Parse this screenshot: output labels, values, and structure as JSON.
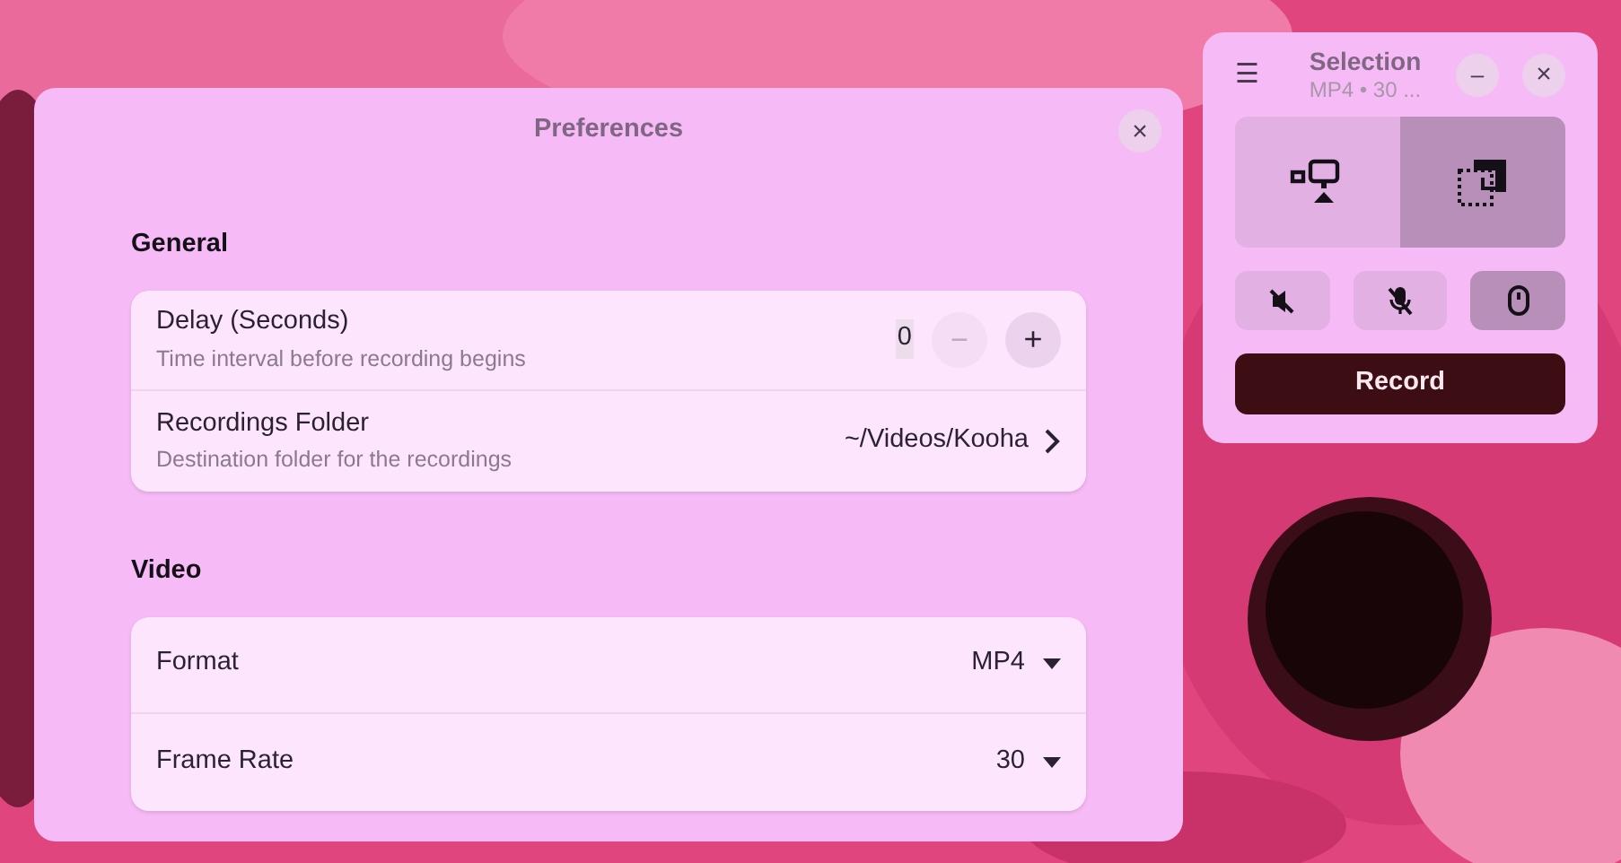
{
  "preferences": {
    "title": "Preferences",
    "close": "×",
    "sections": [
      {
        "title": "General",
        "rows": [
          {
            "kind": "spin",
            "title": "Delay (Seconds)",
            "subtitle": "Time interval before recording begins",
            "value": "0",
            "decrease": "−",
            "increase": "+",
            "decrease_disabled": true
          },
          {
            "kind": "folder",
            "title": "Recordings Folder",
            "subtitle": "Destination folder for the recordings",
            "value": "~/Videos/Kooha"
          }
        ]
      },
      {
        "title": "Video",
        "rows": [
          {
            "kind": "dropdown",
            "title": "Format",
            "value": "MP4"
          },
          {
            "kind": "dropdown",
            "title": "Frame Rate",
            "value": "30"
          }
        ]
      }
    ]
  },
  "recorder": {
    "title": "Selection",
    "subtitle": "MP4 • 30 ...",
    "menu": "☰",
    "minimize": "–",
    "close": "×",
    "modes": [
      {
        "kind": "monitor",
        "selected": false
      },
      {
        "kind": "selection",
        "selected": true
      }
    ],
    "toggles": [
      {
        "kind": "desktop-audio",
        "on": false
      },
      {
        "kind": "microphone",
        "on": false
      },
      {
        "kind": "pointer",
        "on": true
      }
    ],
    "record": "Record"
  }
}
